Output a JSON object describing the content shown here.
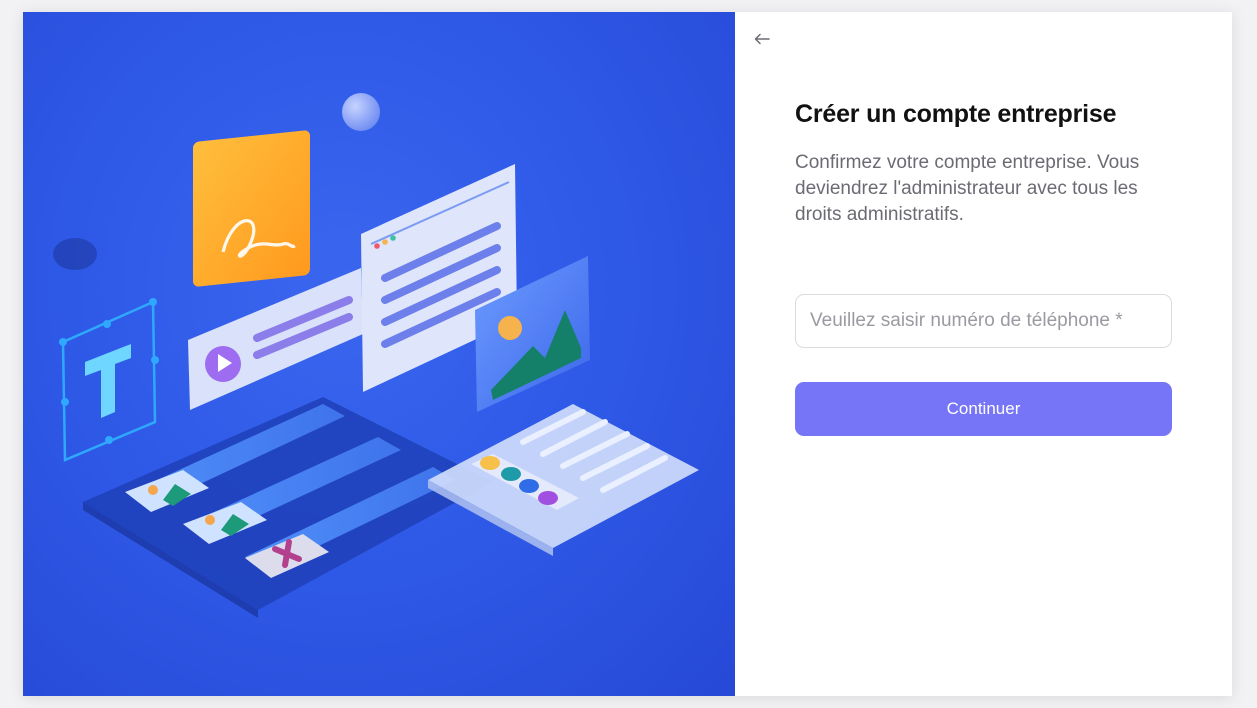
{
  "panel": {
    "title": "Créer un compte entreprise",
    "subtitle": "Confirmez votre compte entreprise. Vous deviendrez l'administrateur avec tous les droits administratifs.",
    "phone_placeholder": "Veuillez saisir numéro de téléphone *",
    "phone_value": "",
    "continue_label": "Continuer",
    "back_icon": "arrow-left-icon"
  },
  "colors": {
    "illustration_bg": "#2f5ae8",
    "button_bg": "#7674f7",
    "title": "#111111",
    "subtitle": "#6b6b73"
  }
}
